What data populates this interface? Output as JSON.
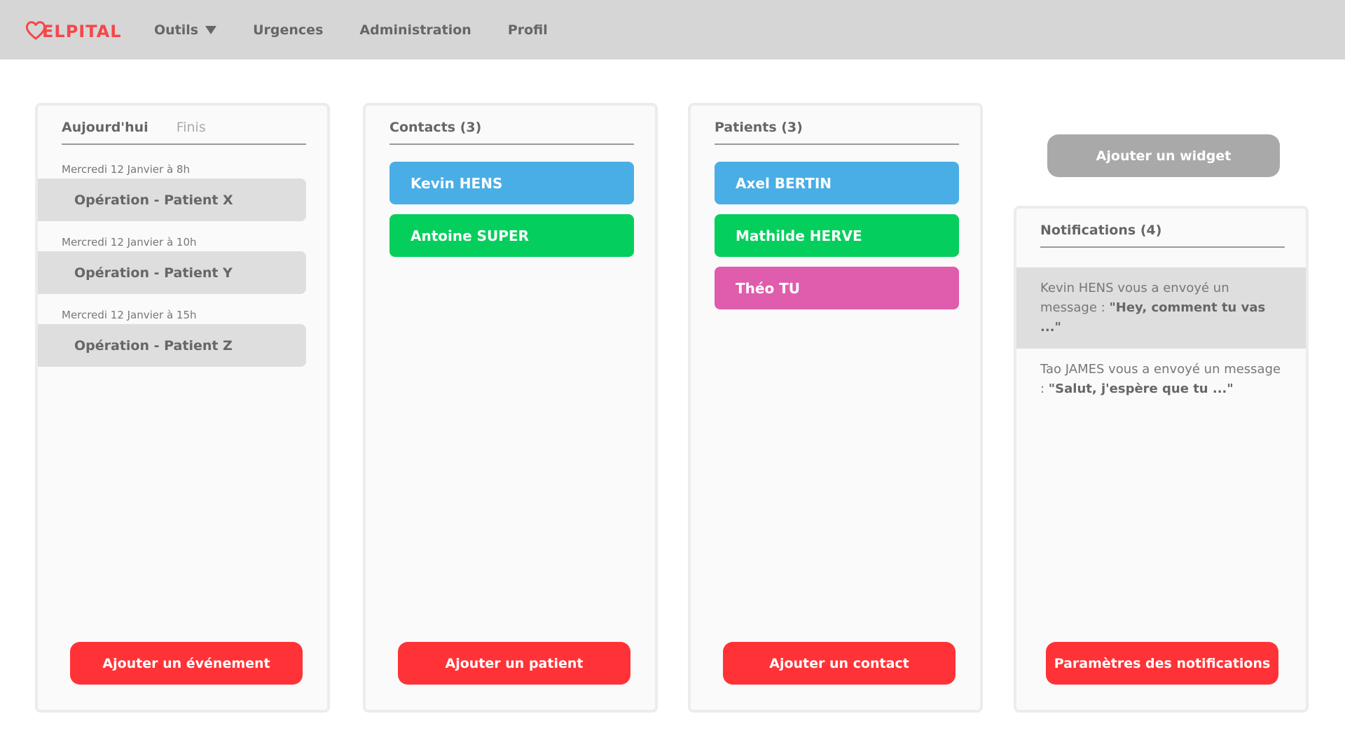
{
  "app": {
    "logo_text": "ELPITAL",
    "brand_color": "#f5474a"
  },
  "nav": {
    "tools": "Outils",
    "emergencies": "Urgences",
    "administration": "Administration",
    "profile": "Profil"
  },
  "events_card": {
    "tab_active": "Aujourd'hui",
    "tab_inactive": "Finis",
    "items": [
      {
        "date": "Mercredi 12 Janvier à 8h",
        "title": "Opération - Patient X"
      },
      {
        "date": "Mercredi 12 Janvier à 10h",
        "title": "Opération - Patient Y"
      },
      {
        "date": "Mercredi 12 Janvier à 15h",
        "title": "Opération - Patient Z"
      }
    ],
    "button": "Ajouter un événement"
  },
  "contacts_card": {
    "title": "Contacts (3)",
    "items": [
      {
        "name": "Kevin HENS",
        "color": "#4aaee6"
      },
      {
        "name": "Antoine SUPER",
        "color": "#05cf5c"
      }
    ],
    "button": "Ajouter un patient"
  },
  "patients_card": {
    "title": "Patients (3)",
    "items": [
      {
        "name": "Axel BERTIN",
        "color": "#4aaee6"
      },
      {
        "name": "Mathilde HERVE",
        "color": "#05cf5c"
      },
      {
        "name": "Théo TU",
        "color": "#e05cad"
      }
    ],
    "button": "Ajouter un contact"
  },
  "widget_button": "Ajouter un widget",
  "notifications_card": {
    "title": "Notifications (4)",
    "items": [
      {
        "prefix": "Kevin HENS vous a envoyé un message : ",
        "quote": "\"Hey, comment tu vas ...\""
      },
      {
        "prefix": "Tao JAMES vous a envoyé un message : ",
        "quote": "\"Salut, j'espère que tu ...\""
      }
    ],
    "button": "Paramètres des notifications"
  }
}
